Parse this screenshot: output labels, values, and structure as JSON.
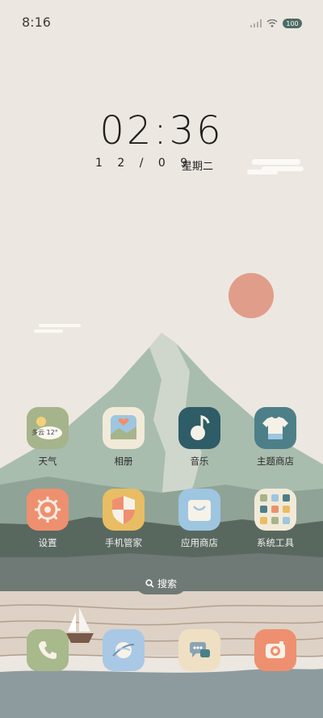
{
  "status_bar": {
    "time": "8:16",
    "battery": "100"
  },
  "lockscreen": {
    "clock": "02:36",
    "date": "1 2 / 0 9",
    "weekday": "星期二"
  },
  "weather_widget": {
    "text": "多云 12°"
  },
  "apps": [
    {
      "label": "天气"
    },
    {
      "label": "相册"
    },
    {
      "label": "音乐"
    },
    {
      "label": "主题商店"
    },
    {
      "label": "设置"
    },
    {
      "label": "手机管家"
    },
    {
      "label": "应用商店"
    },
    {
      "label": "系统工具"
    }
  ],
  "search": {
    "label": "搜索"
  },
  "colors": {
    "background": "#ede7e1",
    "mountain": "#9fb3a4",
    "sun": "#e09e8a",
    "weather_tile": "#a6b48c",
    "music_tile": "#2e5c67",
    "theme_tile": "#4d7f89",
    "settings_tile": "#ee9070",
    "security_tile": "#e8bd63",
    "store_tile": "#9ec6e0",
    "phone_tile": "#a8b98c",
    "browser_tile": "#a9c8e6",
    "messages_tile": "#efe0c4",
    "camera_tile": "#ee9070"
  },
  "dock_icons": [
    "phone-icon",
    "browser-icon",
    "messages-icon",
    "camera-icon"
  ]
}
